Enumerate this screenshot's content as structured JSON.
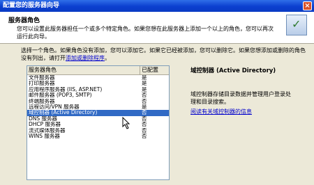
{
  "window": {
    "title": "配置您的服务器向导",
    "close": "×"
  },
  "header": {
    "title": "服务器角色",
    "desc": "您可以设置此服务器担任一个或多个特定角色。如果您想在此服务器上添加一个以上的角色，您可以再次运行此向导。"
  },
  "intro": {
    "text": "选择一个角色。如果角色没有添加，您可以添加它。如果它已经被添加，您可以删除它。如果您想添加或删除的角色没有列出，请打开",
    "link": "添加或删除程序",
    "end": "。"
  },
  "table": {
    "col_role": "服务器角色",
    "col_configured": "已配置",
    "rows": [
      {
        "role": "文件服务器",
        "configured": "是"
      },
      {
        "role": "打印服务器",
        "configured": "是"
      },
      {
        "role": "应用程序服务器 (IIS, ASP.NET)",
        "configured": "是"
      },
      {
        "role": "邮件服务器 (POP3, SMTP)",
        "configured": "否"
      },
      {
        "role": "终端服务器",
        "configured": "否"
      },
      {
        "role": "远程访问/VPN 服务器",
        "configured": "是"
      },
      {
        "role": "域控制器 (Active Directory)",
        "configured": "否"
      },
      {
        "role": "DNS 服务器",
        "configured": "否"
      },
      {
        "role": "DHCP 服务器",
        "configured": "否"
      },
      {
        "role": "流式媒体服务器",
        "configured": "否"
      },
      {
        "role": "WINS 服务器",
        "configured": "否"
      }
    ]
  },
  "detail": {
    "title": "域控制器 (Active Directory)",
    "desc": "域控制器存储目录数据并管理用户登录处理和目录搜索。",
    "link": "阅读有关域控制器的信息"
  }
}
